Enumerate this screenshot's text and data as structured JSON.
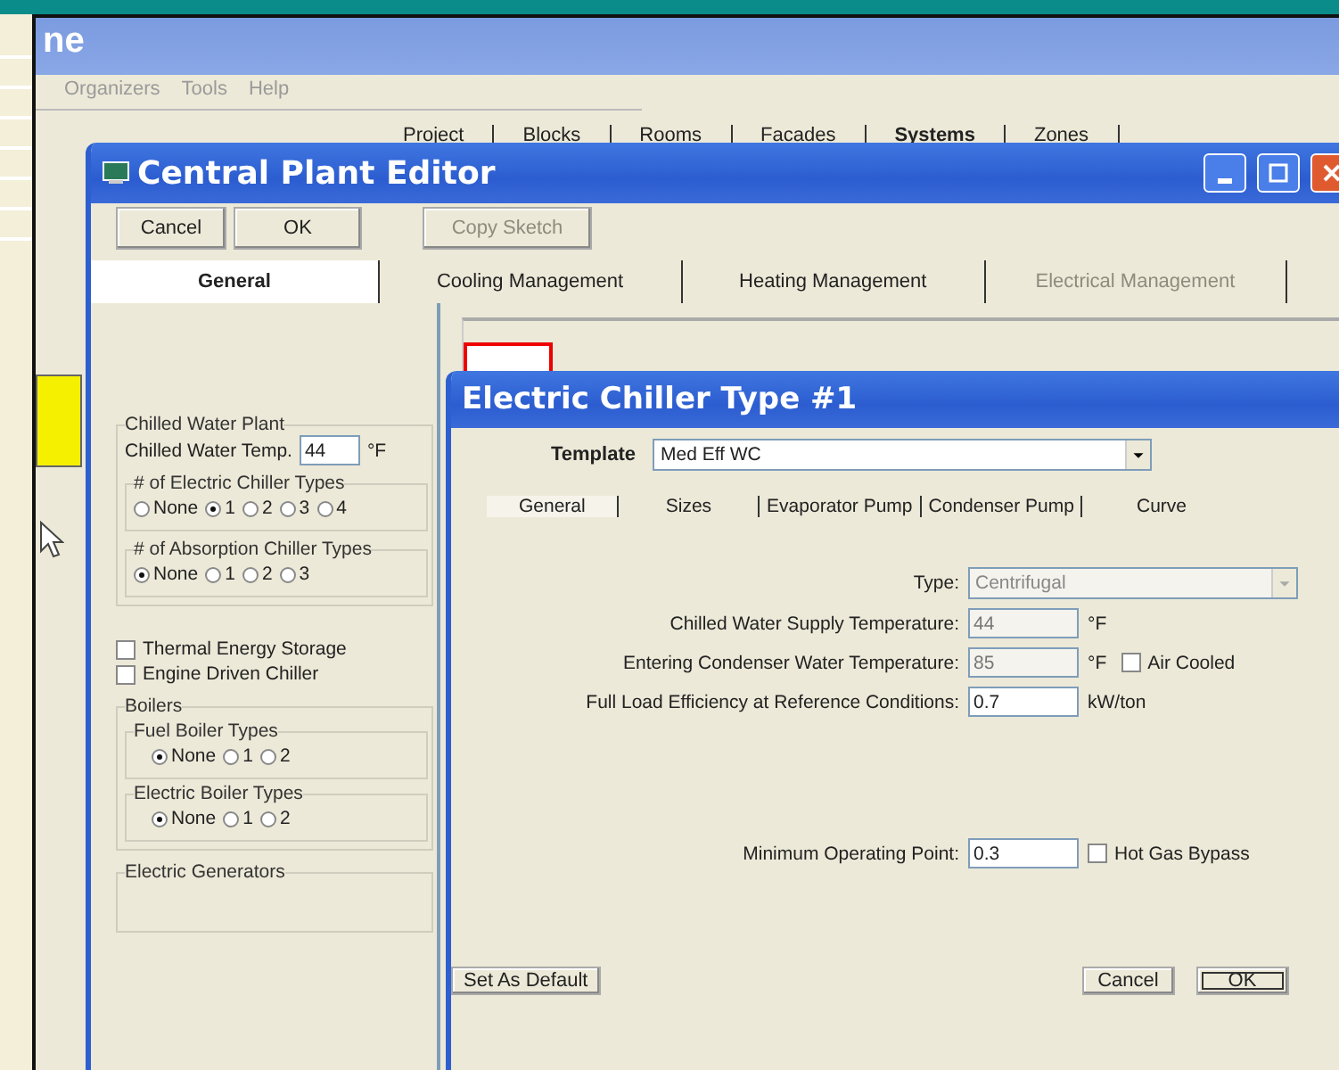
{
  "main_window": {
    "title": "ne",
    "menu": [
      "Organizers",
      "Tools",
      "Help"
    ],
    "tabs": [
      {
        "label": "Project",
        "selected": false
      },
      {
        "label": "Blocks",
        "selected": false
      },
      {
        "label": "Rooms",
        "selected": false
      },
      {
        "label": "Facades",
        "selected": false
      },
      {
        "label": "Systems",
        "selected": true
      },
      {
        "label": "Zones",
        "selected": false
      }
    ]
  },
  "central_plant_editor": {
    "title": "Central Plant Editor",
    "buttons": [
      {
        "label": "Cancel",
        "disabled": false
      },
      {
        "label": "OK",
        "disabled": false
      },
      {
        "label": "Copy Sketch",
        "disabled": true
      }
    ],
    "tabs": [
      {
        "label": "General",
        "selected": true,
        "disabled": false
      },
      {
        "label": "Cooling Management",
        "selected": false,
        "disabled": false
      },
      {
        "label": "Heating Management",
        "selected": false,
        "disabled": false
      },
      {
        "label": "Electrical Management",
        "selected": false,
        "disabled": true
      }
    ],
    "chilled_water_plant": {
      "title": "Chilled Water Plant",
      "temp_label": "Chilled Water Temp.",
      "temp_value": "44",
      "temp_unit": "°F",
      "groups": [
        {
          "title": "# of Electric Chiller Types",
          "options": [
            {
              "label": "None",
              "selected": false
            },
            {
              "label": "1",
              "selected": true
            },
            {
              "label": "2",
              "selected": false
            },
            {
              "label": "3",
              "selected": false
            },
            {
              "label": "4",
              "selected": false
            }
          ]
        },
        {
          "title": "# of Absorption Chiller Types",
          "options": [
            {
              "label": "None",
              "selected": true
            },
            {
              "label": "1",
              "selected": false
            },
            {
              "label": "2",
              "selected": false
            },
            {
              "label": "3",
              "selected": false
            }
          ]
        }
      ]
    },
    "checkboxes": [
      {
        "label": "Thermal Energy Storage",
        "checked": false
      },
      {
        "label": "Engine Driven Chiller",
        "checked": false
      }
    ],
    "boilers": {
      "title": "Boilers",
      "groups": [
        {
          "title": "Fuel Boiler Types",
          "options": [
            {
              "label": "None",
              "selected": true
            },
            {
              "label": "1",
              "selected": false
            },
            {
              "label": "2",
              "selected": false
            }
          ]
        },
        {
          "title": "Electric Boiler Types",
          "options": [
            {
              "label": "None",
              "selected": true
            },
            {
              "label": "1",
              "selected": false
            },
            {
              "label": "2",
              "selected": false
            }
          ]
        }
      ]
    },
    "electric_generators": {
      "title": "Electric Generators"
    }
  },
  "chiller_dialog": {
    "title": "Electric Chiller Type #1",
    "template_label": "Template",
    "template_value": "Med Eff WC",
    "tabs": [
      {
        "label": "General",
        "selected": true
      },
      {
        "label": "Sizes",
        "selected": false
      },
      {
        "label": "Evaporator Pump",
        "selected": false
      },
      {
        "label": "Condenser Pump",
        "selected": false
      },
      {
        "label": "Curve",
        "selected": false
      }
    ],
    "fields": [
      {
        "kind": "select",
        "label": "Type:",
        "value": "Centrifugal",
        "disabled": true
      },
      {
        "kind": "input",
        "label": "Chilled Water Supply Temperature:",
        "value": "44",
        "unit": "°F",
        "disabled": true
      },
      {
        "kind": "input",
        "label": "Entering Condenser Water Temperature:",
        "value": "85",
        "unit": "°F",
        "disabled": true,
        "checkbox": {
          "label": "Air Cooled",
          "checked": false
        }
      },
      {
        "kind": "input",
        "label": "Full Load Efficiency at Reference Conditions:",
        "value": "0.7",
        "unit": "kW/ton",
        "disabled": false
      }
    ],
    "lower_fields": [
      {
        "kind": "input",
        "label": "Minimum Operating Point:",
        "value": "0.3",
        "disabled": false,
        "checkbox": {
          "label": "Hot Gas Bypass",
          "checked": false
        }
      }
    ],
    "buttons": [
      {
        "label": "Set As Default",
        "default": false
      },
      {
        "label": "Cancel",
        "default": false
      },
      {
        "label": "OK",
        "default": true
      }
    ]
  }
}
